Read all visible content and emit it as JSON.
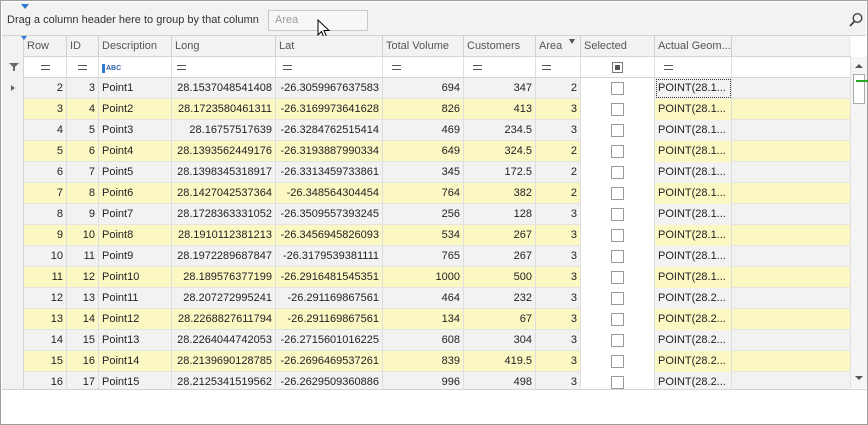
{
  "group_panel": {
    "hint": "Drag a column header here to group by that column",
    "chip_label": "Area"
  },
  "columns": [
    {
      "label": "Row",
      "key": "row"
    },
    {
      "label": "ID",
      "key": "id"
    },
    {
      "label": "Description",
      "key": "description"
    },
    {
      "label": "Long",
      "key": "long"
    },
    {
      "label": "Lat",
      "key": "lat"
    },
    {
      "label": "Total Volume",
      "key": "total_volume"
    },
    {
      "label": "Customers",
      "key": "customers"
    },
    {
      "label": "Area",
      "key": "area"
    },
    {
      "label": "Selected",
      "key": "selected"
    },
    {
      "label": "Actual Geom...",
      "key": "actual_geom"
    }
  ],
  "rows": [
    {
      "row": "2",
      "id": "3",
      "description": "Point1",
      "long": "28.1537048541408",
      "lat": "-26.3059967637583",
      "total_volume": "694",
      "customers": "347",
      "area": "2",
      "actual_geom": "POINT(28.1..."
    },
    {
      "row": "3",
      "id": "4",
      "description": "Point2",
      "long": "28.1723580461311",
      "lat": "-26.3169973641628",
      "total_volume": "826",
      "customers": "413",
      "area": "3",
      "actual_geom": "POINT(28.1..."
    },
    {
      "row": "4",
      "id": "5",
      "description": "Point3",
      "long": "28.16757517639",
      "lat": "-26.3284762515414",
      "total_volume": "469",
      "customers": "234.5",
      "area": "3",
      "actual_geom": "POINT(28.1..."
    },
    {
      "row": "5",
      "id": "6",
      "description": "Point4",
      "long": "28.1393562449176",
      "lat": "-26.3193887990334",
      "total_volume": "649",
      "customers": "324.5",
      "area": "2",
      "actual_geom": "POINT(28.1..."
    },
    {
      "row": "6",
      "id": "7",
      "description": "Point5",
      "long": "28.1398345318917",
      "lat": "-26.3313459733861",
      "total_volume": "345",
      "customers": "172.5",
      "area": "2",
      "actual_geom": "POINT(28.1..."
    },
    {
      "row": "7",
      "id": "8",
      "description": "Point6",
      "long": "28.1427042537364",
      "lat": "-26.348564304454",
      "total_volume": "764",
      "customers": "382",
      "area": "2",
      "actual_geom": "POINT(28.1..."
    },
    {
      "row": "8",
      "id": "9",
      "description": "Point7",
      "long": "28.1728363331052",
      "lat": "-26.3509557393245",
      "total_volume": "256",
      "customers": "128",
      "area": "3",
      "actual_geom": "POINT(28.1..."
    },
    {
      "row": "9",
      "id": "10",
      "description": "Point8",
      "long": "28.1910112381213",
      "lat": "-26.3456945826093",
      "total_volume": "534",
      "customers": "267",
      "area": "3",
      "actual_geom": "POINT(28.1..."
    },
    {
      "row": "10",
      "id": "11",
      "description": "Point9",
      "long": "28.1972289687847",
      "lat": "-26.3179539381111",
      "total_volume": "765",
      "customers": "267",
      "area": "3",
      "actual_geom": "POINT(28.1..."
    },
    {
      "row": "11",
      "id": "12",
      "description": "Point10",
      "long": "28.189576377199",
      "lat": "-26.2916481545351",
      "total_volume": "1000",
      "customers": "500",
      "area": "3",
      "actual_geom": "POINT(28.1..."
    },
    {
      "row": "12",
      "id": "13",
      "description": "Point11",
      "long": "28.207272995241",
      "lat": "-26.291169867561",
      "total_volume": "464",
      "customers": "232",
      "area": "3",
      "actual_geom": "POINT(28.2..."
    },
    {
      "row": "13",
      "id": "14",
      "description": "Point12",
      "long": "28.2268827611794",
      "lat": "-26.291169867561",
      "total_volume": "134",
      "customers": "67",
      "area": "3",
      "actual_geom": "POINT(28.2..."
    },
    {
      "row": "14",
      "id": "15",
      "description": "Point13",
      "long": "28.2264044742053",
      "lat": "-26.2715601016225",
      "total_volume": "608",
      "customers": "304",
      "area": "3",
      "actual_geom": "POINT(28.2..."
    },
    {
      "row": "15",
      "id": "16",
      "description": "Point14",
      "long": "28.2139690128785",
      "lat": "-26.2696469537261",
      "total_volume": "839",
      "customers": "419.5",
      "area": "3",
      "actual_geom": "POINT(28.2..."
    },
    {
      "row": "16",
      "id": "17",
      "description": "Point15",
      "long": "28.2125341519562",
      "lat": "-26.2629509360886",
      "total_volume": "996",
      "customers": "498",
      "area": "3",
      "actual_geom": "POINT(28.2..."
    }
  ],
  "icons": {
    "search": "search-icon",
    "filter": "funnel-icon",
    "string_filter": "abc-filter-icon"
  },
  "colors": {
    "alt_row": "#fcf8c4",
    "row": "#f2f2f2",
    "accent": "#2b79d0"
  }
}
